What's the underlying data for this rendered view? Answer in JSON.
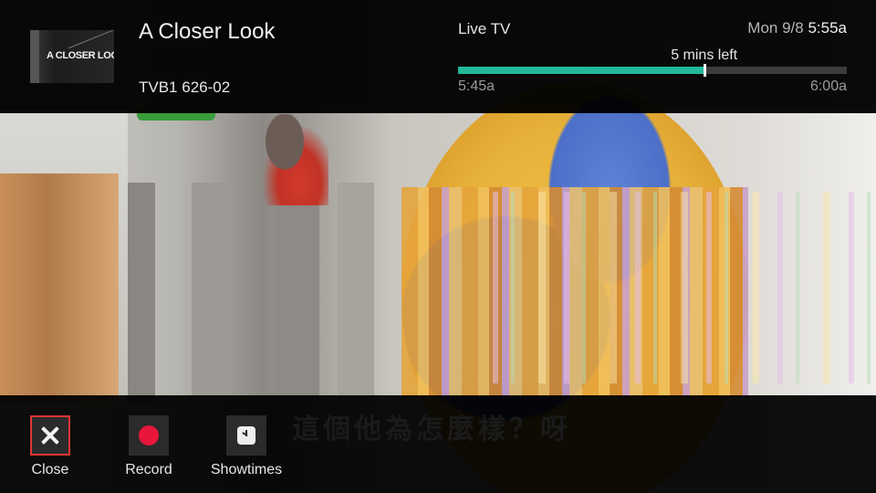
{
  "video": {
    "subtitle_text": "這個他為怎麼樣？呀"
  },
  "header": {
    "thumbnail_text": "A CLOSER LOOK",
    "show_title": "A Closer Look",
    "channel": "TVB1 626-02",
    "mode_label": "Live TV",
    "day_date": "Mon 9/8",
    "current_time": "5:55a",
    "remaining_label": "5 mins left",
    "start_time": "5:45a",
    "end_time": "6:00a",
    "progress_fraction": 0.633,
    "accent_color": "#23b89a"
  },
  "actions": [
    {
      "label": "Close",
      "icon": "close-icon",
      "selected": true
    },
    {
      "label": "Record",
      "icon": "record-icon",
      "selected": false
    },
    {
      "label": "Showtimes",
      "icon": "clock-icon",
      "selected": false
    }
  ],
  "selection_color": "#e03535",
  "record_color": "#e8163a"
}
